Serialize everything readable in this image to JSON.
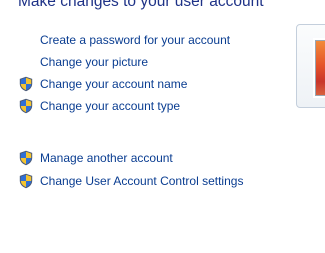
{
  "page": {
    "heading": "Make changes to your user account"
  },
  "tasks": [
    {
      "label": "Create a password for your account",
      "icon": "none"
    },
    {
      "label": "Change your picture",
      "icon": "none"
    },
    {
      "label": "Change your account name",
      "icon": "uac-shield-icon"
    },
    {
      "label": "Change your account type",
      "icon": "uac-shield-icon"
    }
  ],
  "other_tasks": [
    {
      "label": "Manage another account",
      "icon": "uac-shield-icon"
    },
    {
      "label": "Change User Account Control settings",
      "icon": "uac-shield-icon"
    }
  ],
  "colors": {
    "heading": "#1e3287",
    "link": "#0a3d91",
    "shield_blue": "#2f6fd6",
    "shield_yellow": "#f4c430"
  }
}
